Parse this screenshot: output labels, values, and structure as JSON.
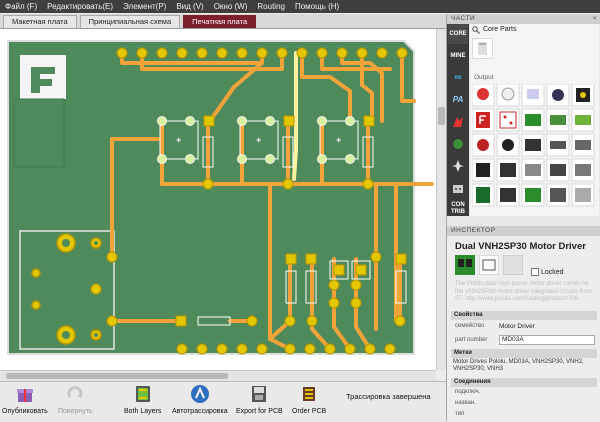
{
  "menu": [
    "Файл (F)",
    "Редактировать(E)",
    "Элемент(P)",
    "Вид (V)",
    "Окно (W)",
    "Routing",
    "Помощь (H)"
  ],
  "tabs": [
    {
      "label": "Макетная плата",
      "active": false
    },
    {
      "label": "Принципиальная схема",
      "active": false
    },
    {
      "label": "Печатная плата",
      "active": true
    }
  ],
  "toolbar": {
    "share": "Опубликовать",
    "rotate": "Повернуть",
    "layers": "Both Layers",
    "autoroute": "Автотрассировка",
    "export": "Export for PCB",
    "order": "Order PCB",
    "status": "Трассировка завершена"
  },
  "parts_panel": {
    "title": "ЧАСТИ",
    "close": "×",
    "bin_label": "Core Parts",
    "output_label": "Output",
    "bins": [
      "CORE",
      "MINE",
      "∞",
      "PA",
      "CON TRIB"
    ]
  },
  "inspector": {
    "title": "ИНСПЕКТОР",
    "part_name": "Dual VNH2SP30 Motor Driver",
    "locked_label": "Locked",
    "description": "The Pololu dual high-power motor driver carrier for the VNH2SP30 motor driver integrated circuits from ST. http://www.pololu.com/catalog/product/706",
    "properties_header": "Свойства",
    "family_label": "семейство",
    "family_value": "Motor Driver",
    "part_number_label": "part number",
    "part_number_value": "MD03A",
    "tags_header": "Метки",
    "tags_value": "Motor Drives Pololu, MD03A, VNH2SP30, VNH2, VNH2SP30, VNH3",
    "connections_header": "Соединения",
    "conn_label": "подключ.",
    "name_label": "назван.",
    "type_label": "тип"
  },
  "colors": {
    "board": "#4f8a5b",
    "trace": "#f2a33a",
    "pad": "#e2c600",
    "active_tab": "#7e1f2e",
    "menubar": "#3f3f3f"
  }
}
